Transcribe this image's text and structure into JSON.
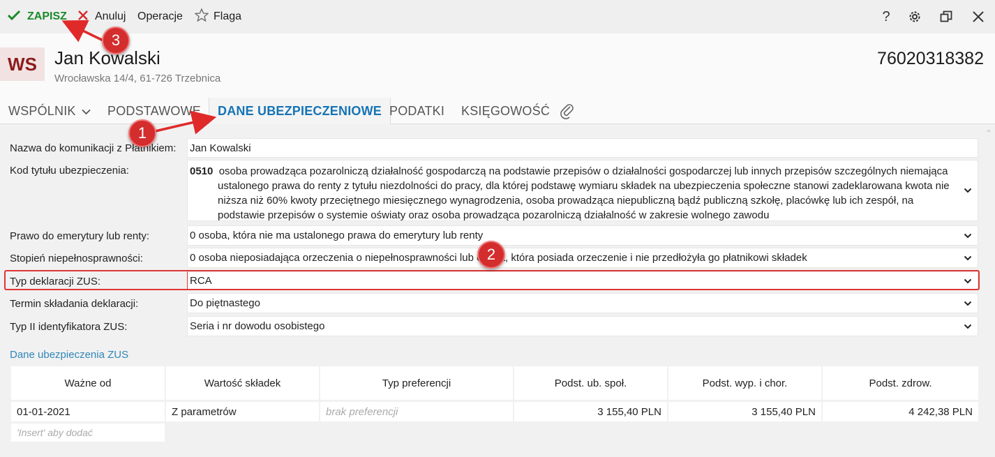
{
  "toolbar": {
    "save_label": "ZAPISZ",
    "cancel_label": "Anuluj",
    "operations_label": "Operacje",
    "flag_label": "Flaga",
    "icons": [
      "check-icon",
      "close-x-icon",
      "star-icon",
      "help-icon",
      "gear-icon",
      "restore-window-icon",
      "close-window-icon"
    ],
    "help_glyph": "?"
  },
  "header": {
    "avatar_initials": "WS",
    "name": "Jan Kowalski",
    "address": "Wrocławska 14/4, 61-726 Trzebnica",
    "id_number": "76020318382"
  },
  "tabs": [
    {
      "label": "WSPÓLNIK"
    },
    {
      "label": "PODSTAWOWE"
    },
    {
      "label": "DANE UBEZPIECZENIOWE"
    },
    {
      "label": "PODATKI"
    },
    {
      "label": "KSIĘGOWOŚĆ"
    }
  ],
  "form": {
    "communication_name_label": "Nazwa do komunikacji z Płatnikiem:",
    "communication_name_value": "Jan Kowalski",
    "insurance_code_label": "Kod tytułu ubezpieczenia:",
    "insurance_code": "0510",
    "insurance_code_desc": "osoba prowadząca pozarolniczą działalność gospodarczą na podstawie przepisów o działalności gospodarczej lub innych przepisów szczególnych niemająca ustalonego prawa do renty z tytułu niezdolności do pracy, dla której podstawę wymiaru składek na ubezpieczenia społeczne stanowi zadeklarowana kwota nie niższa niż 60% kwoty przeciętnego miesięcznego wynagrodzenia, osoba prowadząca niepubliczną bądź publiczną szkołę, placówkę lub ich zespół, na podstawie przepisów o systemie oświaty oraz osoba prowadząca pozarolniczą działalność w zakresie wolnego zawodu",
    "pension_label": "Prawo do emerytury lub renty:",
    "pension_value": "0  osoba, która nie ma ustalonego prawa do emerytury lub renty",
    "disability_label": "Stopień niepełnosprawności:",
    "disability_value": "0  osoba nieposiadająca orzeczenia o niepełnosprawności lub osoba, która posiada orzeczenie i nie przedłożyła go płatnikowi składek",
    "declaration_type_label": "Typ deklaracji ZUS:",
    "declaration_type_value": "RCA",
    "deadline_label": "Termin składania deklaracji:",
    "deadline_value": "Do piętnastego",
    "id_type_label": "Typ II identyfikatora ZUS:",
    "id_type_value": "Seria i nr dowodu osobistego"
  },
  "section_link": "Dane ubezpieczenia ZUS",
  "table": {
    "headers": [
      "Ważne od",
      "Wartość składek",
      "Typ preferencji",
      "Podst. ub. społ.",
      "Podst. wyp. i chor.",
      "Podst. zdrow."
    ],
    "rows": [
      [
        "01-01-2021",
        "Z parametrów",
        "brak preferencji",
        "3 155,40 PLN",
        "3 155,40 PLN",
        "4 242,38 PLN"
      ]
    ],
    "insert_hint": "'Insert' aby dodać"
  },
  "annotations": {
    "badge_1": "1",
    "badge_2": "2",
    "badge_3": "3",
    "color": "#d42d2d"
  },
  "colors": {
    "accent": "#1674b5",
    "save": "#1a8a2a",
    "highlight": "#e03535"
  }
}
